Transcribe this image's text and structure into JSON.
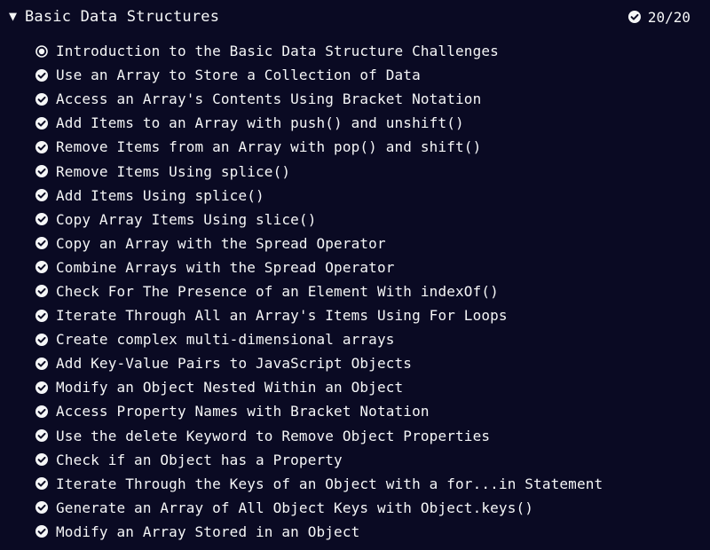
{
  "block": {
    "caret_icon": "triangle-down-icon",
    "title": "Basic Data Structures",
    "progress_icon": "check-circle-icon",
    "progress_text": "20/20"
  },
  "challenges": [
    {
      "title": "Introduction to the Basic Data Structure Challenges",
      "status": "current",
      "icon": "radio-dot-icon"
    },
    {
      "title": "Use an Array to Store a Collection of Data",
      "status": "completed",
      "icon": "check-circle-icon"
    },
    {
      "title": "Access an Array's Contents Using Bracket Notation",
      "status": "completed",
      "icon": "check-circle-icon"
    },
    {
      "title": "Add Items to an Array with push() and unshift()",
      "status": "completed",
      "icon": "check-circle-icon"
    },
    {
      "title": "Remove Items from an Array with pop() and shift()",
      "status": "completed",
      "icon": "check-circle-icon"
    },
    {
      "title": "Remove Items Using splice()",
      "status": "completed",
      "icon": "check-circle-icon"
    },
    {
      "title": "Add Items Using splice()",
      "status": "completed",
      "icon": "check-circle-icon"
    },
    {
      "title": "Copy Array Items Using slice()",
      "status": "completed",
      "icon": "check-circle-icon"
    },
    {
      "title": "Copy an Array with the Spread Operator",
      "status": "completed",
      "icon": "check-circle-icon"
    },
    {
      "title": "Combine Arrays with the Spread Operator",
      "status": "completed",
      "icon": "check-circle-icon"
    },
    {
      "title": "Check For The Presence of an Element With indexOf()",
      "status": "completed",
      "icon": "check-circle-icon"
    },
    {
      "title": "Iterate Through All an Array's Items Using For Loops",
      "status": "completed",
      "icon": "check-circle-icon"
    },
    {
      "title": "Create complex multi-dimensional arrays",
      "status": "completed",
      "icon": "check-circle-icon"
    },
    {
      "title": "Add Key-Value Pairs to JavaScript Objects",
      "status": "completed",
      "icon": "check-circle-icon"
    },
    {
      "title": "Modify an Object Nested Within an Object",
      "status": "completed",
      "icon": "check-circle-icon"
    },
    {
      "title": "Access Property Names with Bracket Notation",
      "status": "completed",
      "icon": "check-circle-icon"
    },
    {
      "title": "Use the delete Keyword to Remove Object Properties",
      "status": "completed",
      "icon": "check-circle-icon"
    },
    {
      "title": "Check if an Object has a Property",
      "status": "completed",
      "icon": "check-circle-icon"
    },
    {
      "title": "Iterate Through the Keys of an Object with a for...in Statement",
      "status": "completed",
      "icon": "check-circle-icon"
    },
    {
      "title": "Generate an Array of All Object Keys with Object.keys()",
      "status": "completed",
      "icon": "check-circle-icon"
    },
    {
      "title": "Modify an Array Stored in an Object",
      "status": "completed",
      "icon": "check-circle-icon"
    }
  ],
  "colors": {
    "background": "#0a0a23",
    "text": "#f5f6f7"
  }
}
